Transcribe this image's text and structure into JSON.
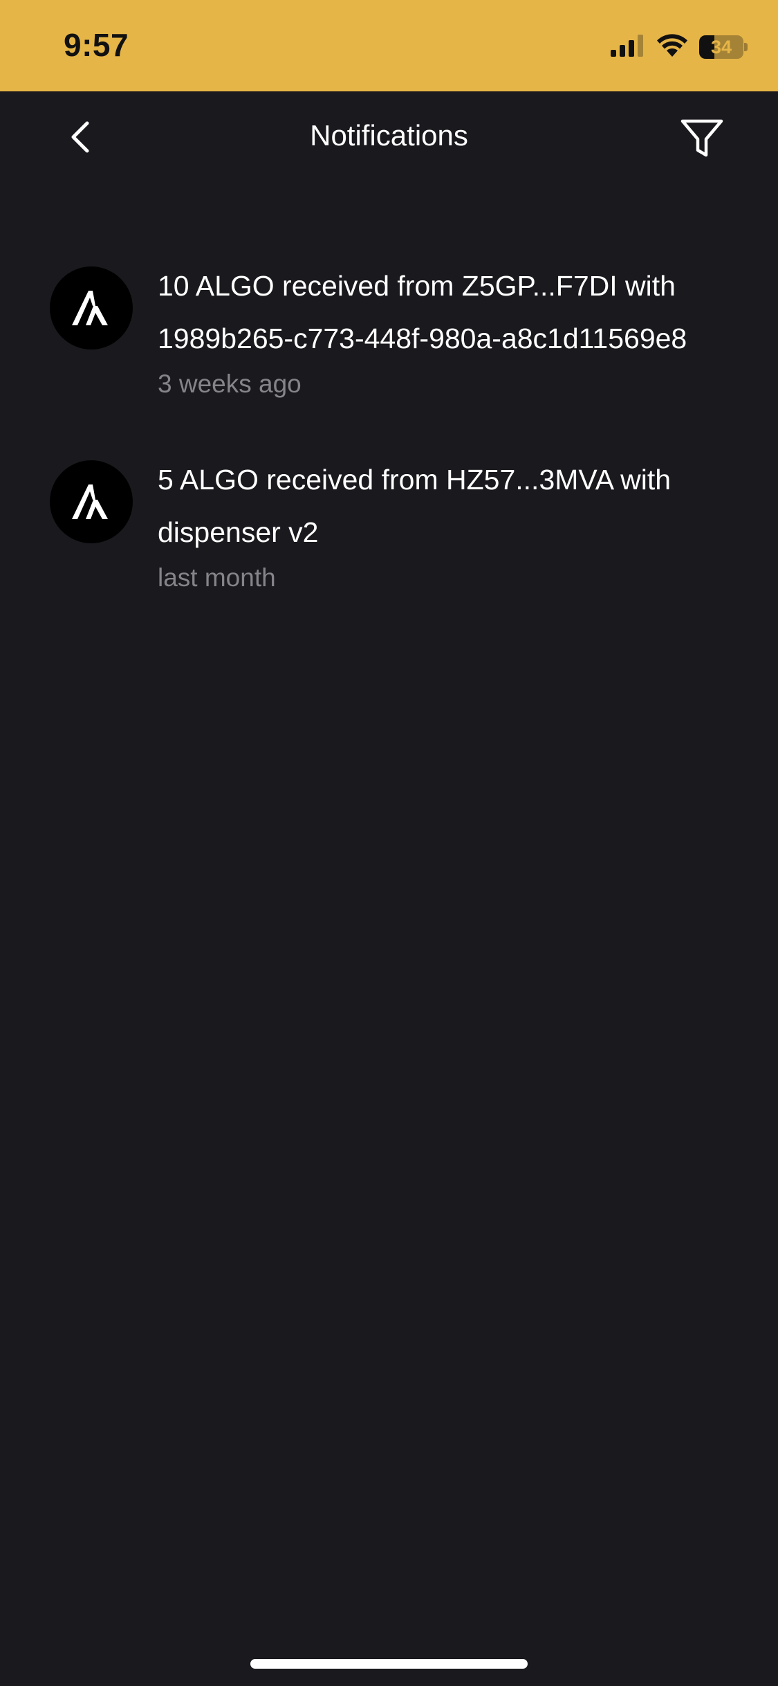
{
  "status_bar": {
    "time": "9:57",
    "battery_level": "34",
    "battery_fraction": 0.34,
    "background_color": "#e6b547"
  },
  "header": {
    "title": "Notifications",
    "back_icon": "chevron-left-icon",
    "filter_icon": "filter-icon"
  },
  "notifications": [
    {
      "icon": "algorand-logo-icon",
      "text": "10 ALGO received from Z5GP...F7DI with 1989b265-c773-448f-980a-a8c1d11569e8",
      "time": "3 weeks ago"
    },
    {
      "icon": "algorand-logo-icon",
      "text": "5 ALGO received from HZ57...3MVA with dispenser v2",
      "time": "last month"
    }
  ],
  "colors": {
    "background": "#1a191e",
    "text_primary": "#ffffff",
    "text_secondary": "#858489",
    "accent": "#e6b547"
  }
}
